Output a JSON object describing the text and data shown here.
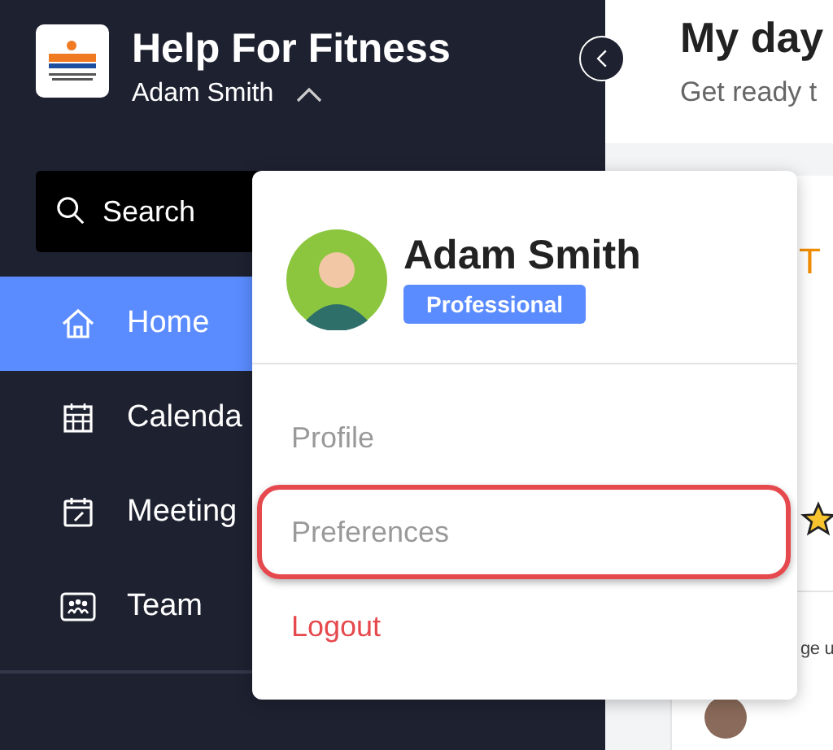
{
  "app": {
    "title": "Help For Fitness",
    "user_name": "Adam Smith"
  },
  "search": {
    "placeholder": "Search"
  },
  "nav": [
    {
      "label": "Home",
      "kind": "home",
      "selected": true
    },
    {
      "label": "Calenda",
      "kind": "calendar",
      "selected": false
    },
    {
      "label": "Meeting",
      "kind": "meeting",
      "selected": false
    },
    {
      "label": "Team",
      "kind": "team",
      "selected": false
    }
  ],
  "main": {
    "title": "My day",
    "subtitle": "Get ready t",
    "task_label": "T",
    "note": "ge u"
  },
  "user_menu": {
    "name": "Adam Smith",
    "plan": "Professional",
    "items": [
      {
        "label": "Profile",
        "kind": "link",
        "highlighted": false
      },
      {
        "label": "Preferences",
        "kind": "link",
        "highlighted": true
      },
      {
        "label": "Logout",
        "kind": "danger",
        "highlighted": false
      }
    ]
  }
}
